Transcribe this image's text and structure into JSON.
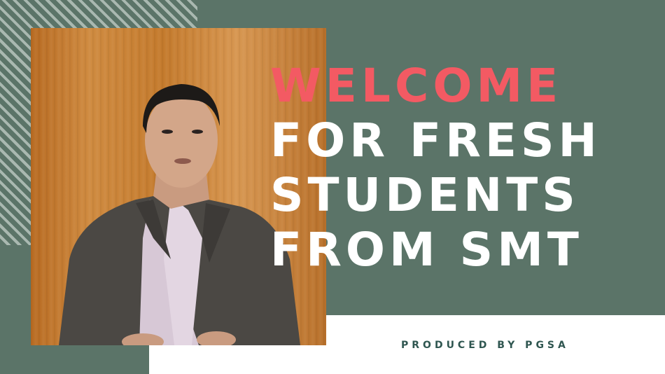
{
  "title": {
    "line1": "WELCOME",
    "line2": "FOR FRESH",
    "line3": "STUDENTS",
    "line4": "FROM SMT"
  },
  "credit": "PRODUCED BY PGSA",
  "colors": {
    "background": "#5b7468",
    "stripe": "#a9b8b0",
    "accent_red": "#f35a63",
    "title_white": "#ffffff",
    "credit_text": "#2f5650",
    "panel_white": "#ffffff",
    "wood": "#c47a2c"
  }
}
